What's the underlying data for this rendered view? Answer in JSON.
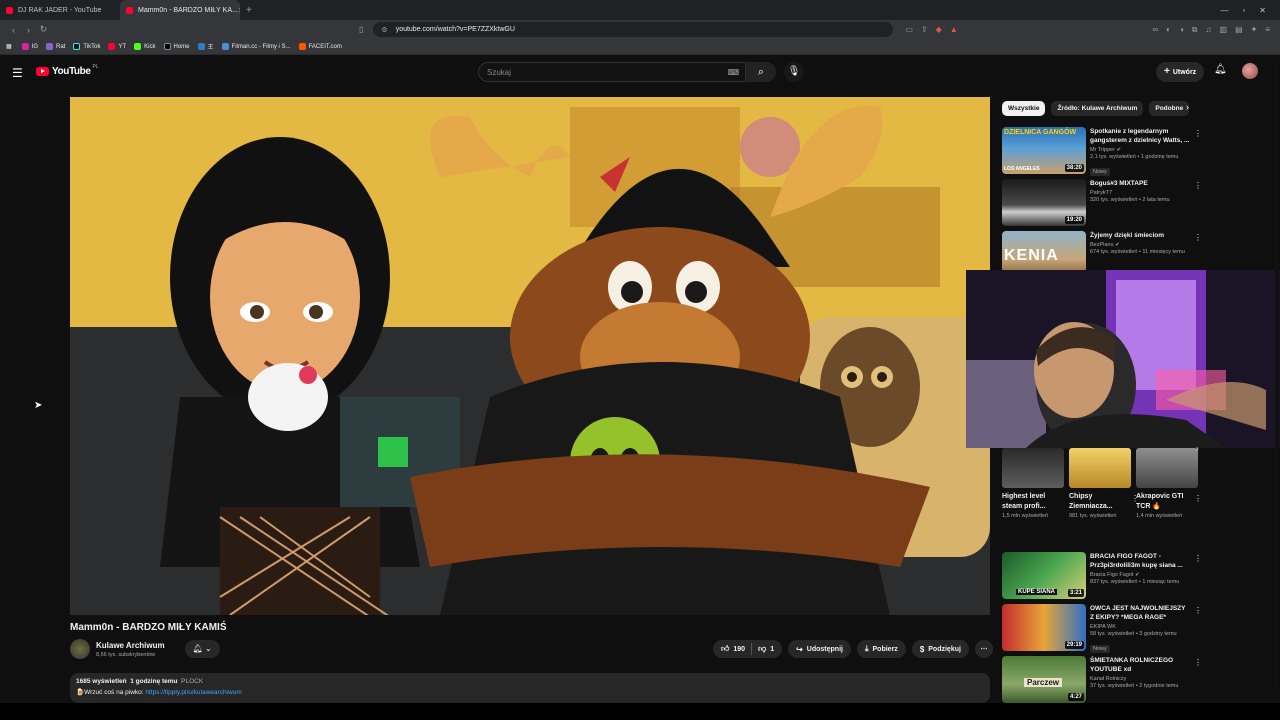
{
  "browser": {
    "tabs": [
      {
        "title": "DJ RAK JADER - YouTube",
        "active": false
      },
      {
        "title": "Mamm0n - BARDZO MIŁY KA...",
        "active": true
      }
    ],
    "url": "youtube.com/watch?v=PE7ZZXktwGU",
    "bookmarks": [
      "IG",
      "Rat",
      "TikTok",
      "YT",
      "Kick",
      "Home",
      "王",
      "Filman.cc - Filmy i S...",
      "FACEIT.com"
    ]
  },
  "header": {
    "logo": "YouTube",
    "country": "PL",
    "search_placeholder": "Szukaj",
    "create_label": "Utwórz"
  },
  "video": {
    "title": "Mamm0n - BARDZO MIŁY KAMIŚ",
    "channel": "Kulawe Archiwum",
    "subscribers": "8,66 tys. subskrybentów",
    "likes": "190",
    "dislikes": "1",
    "share": "Udostępnij",
    "download": "Pobierz",
    "thanks": "Podziękuj",
    "views": "1685 wyświetleń",
    "time": "1 godzinę temu",
    "location": "PLOCK",
    "desc_prefix": "🍺Wrzuć coś na piwko:",
    "desc_link": "https://tipply.pl/u/kulawearchiwum"
  },
  "sidebar": {
    "chips": [
      "Wszystkie",
      "Źródło: Kulawe Archiwum",
      "Podobne"
    ],
    "recs_top": [
      {
        "title": "Spotkanie z legendarnym gangsterem z dzielnicy Watts, ...",
        "channel": "Mr Tripper",
        "meta": "2,1 tys. wyświetleń • 1 godzinę temu",
        "badge": "Nowy",
        "duration": "38:20"
      },
      {
        "title": "Boguś#3 MIXTAPE",
        "channel": "PatrykT7",
        "meta": "320 tys. wyświetleń • 2 lata temu",
        "badge": "",
        "duration": "19:20"
      },
      {
        "title": "Żyjemy dzięki śmieciom",
        "channel": "BezPlanu",
        "meta": "674 tys. wyświetleń • 11 miesięcy temu",
        "badge": "",
        "duration": ""
      }
    ],
    "shorts": [
      {
        "title": "Highest level steam profi...",
        "views": "1,5 mln wyświetleń"
      },
      {
        "title": "Chipsy Ziemniacza...",
        "views": "981 tys. wyświetleń"
      },
      {
        "title": "Akrapovic GTI TCR 🔥",
        "views": "1,4 mln wyświetleń"
      }
    ],
    "recs_bottom": [
      {
        "title": "BRACIA FIGO FAGOT - Prz3pi3rdolili3m kupę siana ...",
        "channel": "Bracia Figo Fagot",
        "meta": "837 tys. wyświetleń • 1 miesiąc temu",
        "badge": "",
        "duration": "3:21"
      },
      {
        "title": "OWCA JEST NAJWOLNIEJSZY Z EKIPY? *MEGA RAGE*",
        "channel": "EKIPA WK",
        "meta": "58 tys. wyświetleń • 3 godziny temu",
        "badge": "Nowy",
        "duration": "29:19"
      },
      {
        "title": "ŚMIETANKA ROLNICZEGO YOUTUBE xd",
        "channel": "Kanał Rolniczy",
        "meta": "37 tys. wyświetleń • 2 tygodnie temu",
        "badge": "",
        "duration": "4:27"
      }
    ],
    "thumb_texts": {
      "r1_top": "DZIELNICA GANGÓW",
      "r1_bottom": "LOS ANGELES",
      "r3": "KENIA",
      "b1": "KUPE SIANA",
      "b3": "Parczew"
    }
  }
}
